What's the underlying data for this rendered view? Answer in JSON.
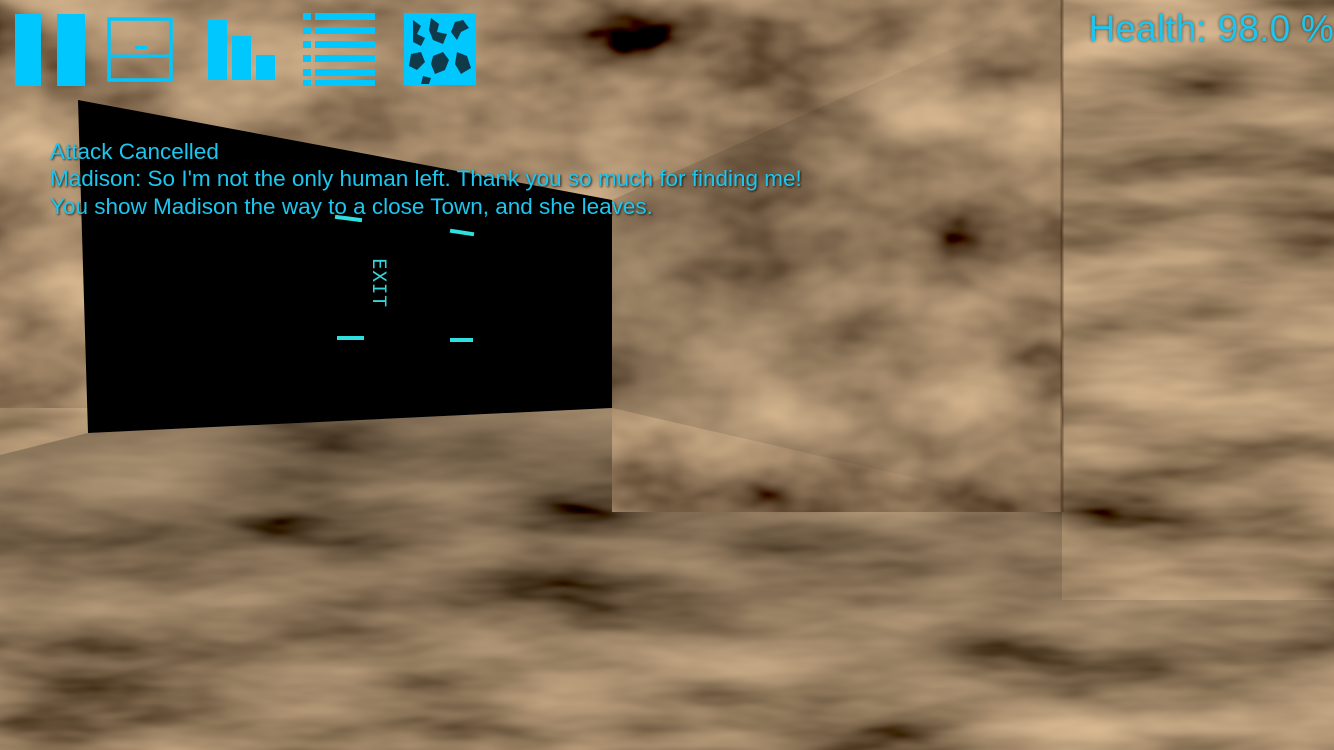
{
  "hud": {
    "buttons": [
      {
        "name": "pause-icon"
      },
      {
        "name": "inventory-icon"
      },
      {
        "name": "stats-icon"
      },
      {
        "name": "list-icon"
      },
      {
        "name": "map-icon"
      }
    ],
    "health_text": "Health: 98.0 %",
    "health_value": 98.0
  },
  "log": {
    "lines": [
      "Attack Cancelled",
      "Madison: So I'm not the only human left. Thank you so much for finding me!",
      "You show Madison the way to a close Town, and she leaves."
    ]
  },
  "scene": {
    "exit_label": "EXIT"
  },
  "colors": {
    "hud_cyan": "#00c8ff",
    "text_cyan": "#1cc6ee",
    "wall_brown": "#8a5a2e",
    "dark_brown": "#3a2410",
    "doorway": "#000000"
  }
}
